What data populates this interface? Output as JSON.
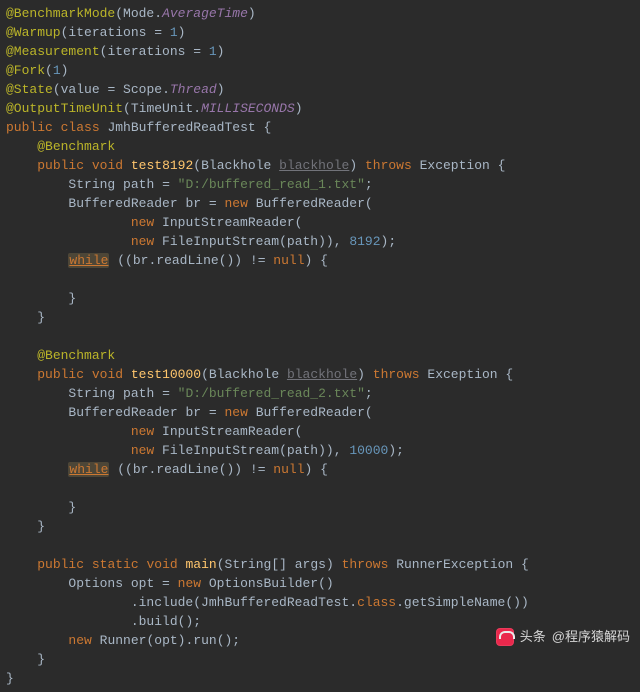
{
  "annotations": {
    "benchmarkMode": "@BenchmarkMode",
    "benchmarkModeArgOwner": "Mode",
    "benchmarkModeArgValue": "AverageTime",
    "warmup": "@Warmup",
    "warmupArgName": "iterations",
    "warmupArgVal": "1",
    "measurement": "@Measurement",
    "measurementArgName": "iterations",
    "measurementArgVal": "1",
    "fork": "@Fork",
    "forkArg": "1",
    "state": "@State",
    "stateArgName": "value",
    "stateArgOwner": "Scope",
    "stateArgValue": "Thread",
    "outputTimeUnit": "@OutputTimeUnit",
    "outputTimeUnitArgOwner": "TimeUnit",
    "outputTimeUnitArgValue": "MILLISECONDS",
    "benchmark": "@Benchmark"
  },
  "kw": {
    "public": "public",
    "class": "class",
    "void": "void",
    "throws": "throws",
    "new": "new",
    "while": "while",
    "null": "null",
    "static": "static"
  },
  "ids": {
    "className": "JmhBufferedReadTest",
    "blackhole": "Blackhole",
    "blackholeParam": "blackhole",
    "exception": "Exception",
    "string": "String",
    "bufferedReader": "BufferedReader",
    "inputStreamReader": "InputStreamReader",
    "fileInputStream": "FileInputStream",
    "options": "Options",
    "optionsBuilder": "OptionsBuilder",
    "runner": "Runner",
    "runnerException": "RunnerException"
  },
  "methods": {
    "m1": "test8192",
    "m2": "test10000",
    "main": "main"
  },
  "locals": {
    "path": "path",
    "br": "br",
    "opt": "opt",
    "args": "args"
  },
  "strings": {
    "path1": "\"D:/buffered_read_1.txt\"",
    "path2": "\"D:/buffered_read_2.txt\""
  },
  "nums": {
    "buf1": "8192",
    "buf2": "10000"
  },
  "calls": {
    "readLine": "readLine",
    "include": "include",
    "getSimpleName": "getSimpleName",
    "build": "build",
    "run": "run"
  },
  "watermark": {
    "prefix": "头条",
    "handle": "@程序猿解码"
  }
}
